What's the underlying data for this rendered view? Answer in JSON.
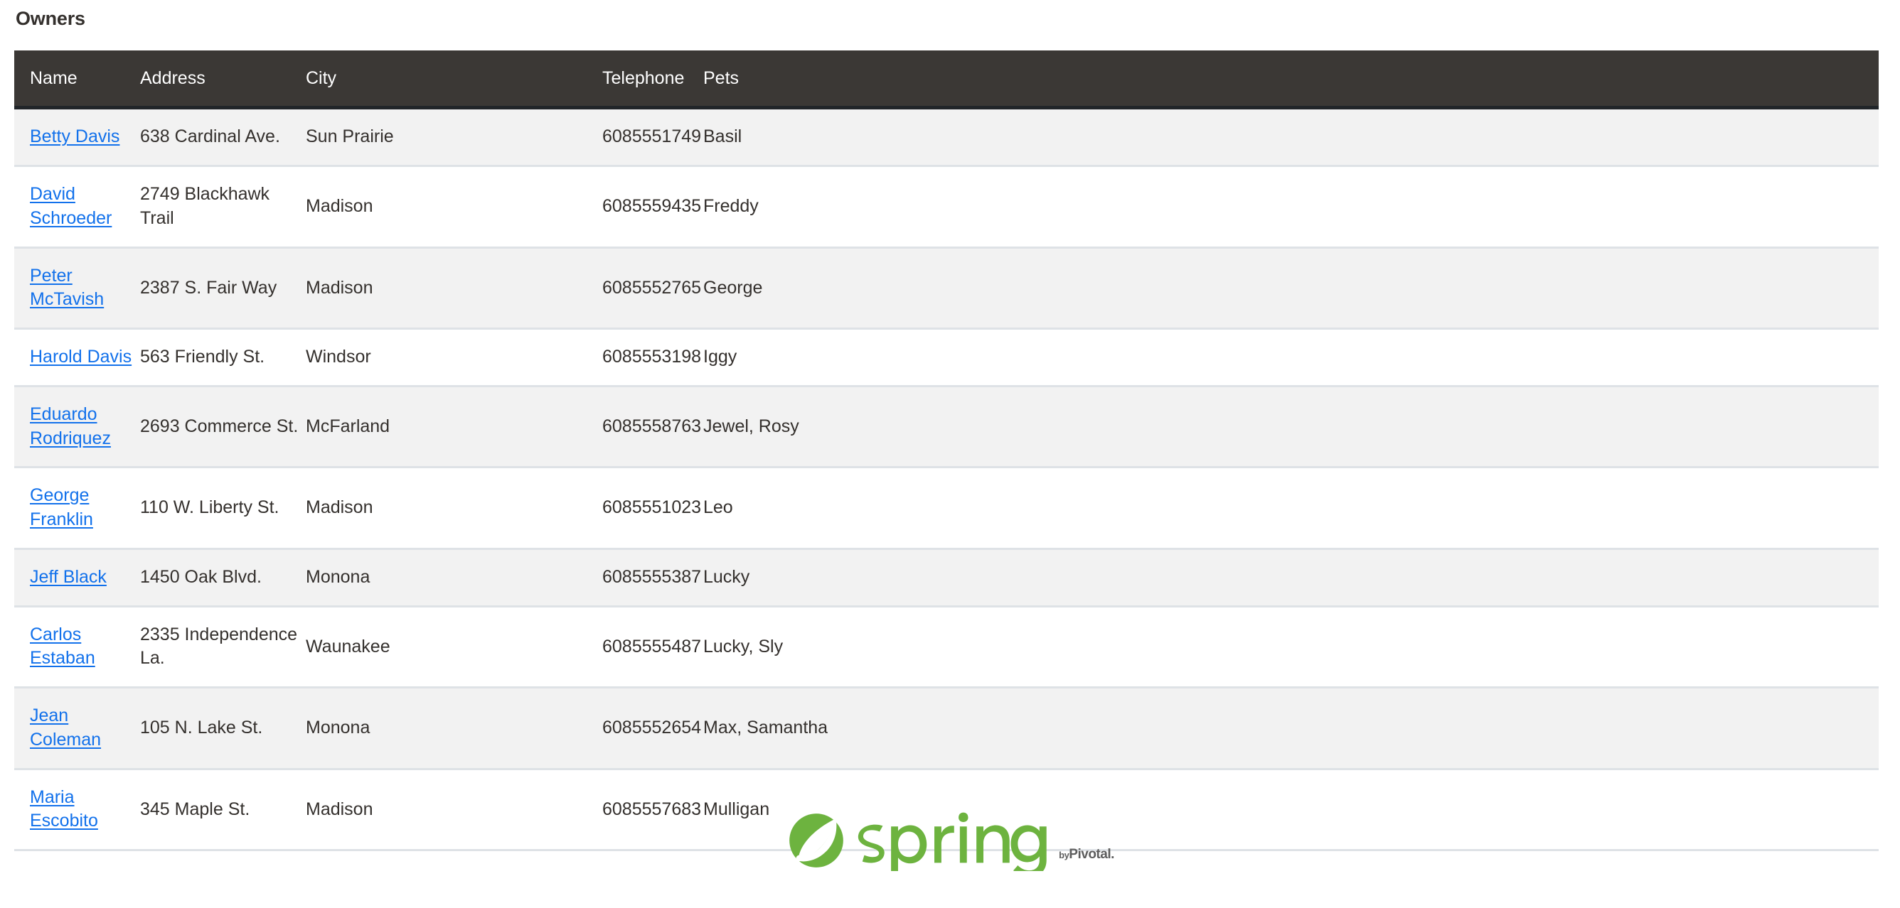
{
  "page": {
    "title": "Owners"
  },
  "table": {
    "columns": [
      {
        "key": "name",
        "label": "Name"
      },
      {
        "key": "address",
        "label": "Address"
      },
      {
        "key": "city",
        "label": "City"
      },
      {
        "key": "telephone",
        "label": "Telephone"
      },
      {
        "key": "pets",
        "label": "Pets"
      }
    ],
    "header_bg": "#3b3835",
    "header_border": "#212529",
    "stripe_bg": "#f2f2f2",
    "row_border": "#dee2e6",
    "link_color": "#1271eb",
    "rows": [
      {
        "name": "Betty Davis",
        "address": "638 Cardinal Ave.",
        "city": "Sun Prairie",
        "telephone": "6085551749",
        "pets": "Basil"
      },
      {
        "name": "David Schroeder",
        "address": "2749 Blackhawk Trail",
        "city": "Madison",
        "telephone": "6085559435",
        "pets": "Freddy"
      },
      {
        "name": "Peter McTavish",
        "address": "2387 S. Fair Way",
        "city": "Madison",
        "telephone": "6085552765",
        "pets": "George"
      },
      {
        "name": "Harold Davis",
        "address": "563 Friendly St.",
        "city": "Windsor",
        "telephone": "6085553198",
        "pets": "Iggy"
      },
      {
        "name": "Eduardo Rodriquez",
        "address": "2693 Commerce St.",
        "city": "McFarland",
        "telephone": "6085558763",
        "pets": "Jewel, Rosy"
      },
      {
        "name": "George Franklin",
        "address": "110 W. Liberty St.",
        "city": "Madison",
        "telephone": "6085551023",
        "pets": "Leo"
      },
      {
        "name": "Jeff Black",
        "address": "1450 Oak Blvd.",
        "city": "Monona",
        "telephone": "6085555387",
        "pets": "Lucky"
      },
      {
        "name": "Carlos Estaban",
        "address": "2335 Independence La.",
        "city": "Waunakee",
        "telephone": "6085555487",
        "pets": "Lucky, Sly"
      },
      {
        "name": "Jean Coleman",
        "address": "105 N. Lake St.",
        "city": "Monona",
        "telephone": "6085552654",
        "pets": "Max, Samantha"
      },
      {
        "name": "Maria Escobito",
        "address": "345 Maple St.",
        "city": "Madison",
        "telephone": "6085557683",
        "pets": "Mulligan"
      }
    ]
  },
  "footer": {
    "logo_word": "spring",
    "logo_by": "by",
    "logo_brand": "Pivotal.",
    "logo_color": "#6db33f",
    "byline_color": "#5d5d5d"
  }
}
